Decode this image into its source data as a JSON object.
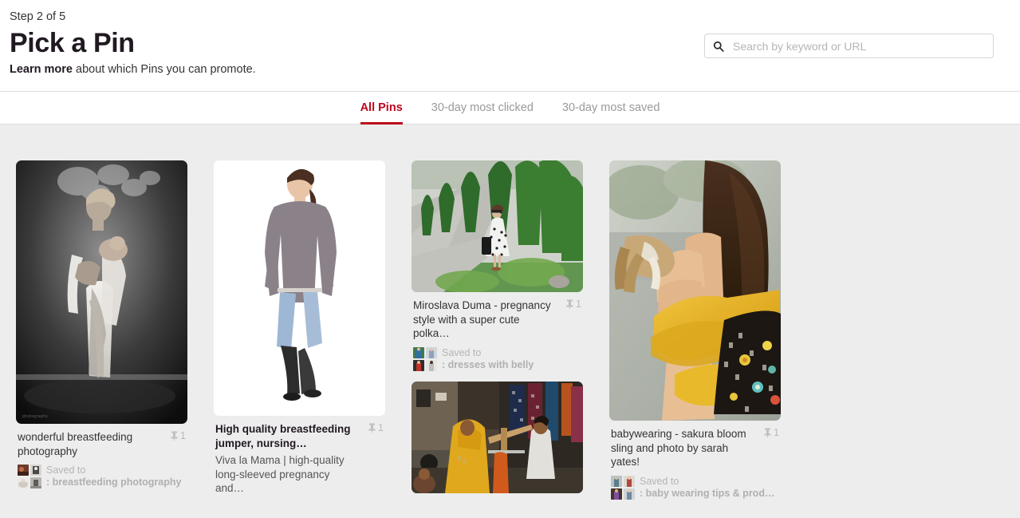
{
  "header": {
    "step_label": "Step 2 of 5",
    "title": "Pick a Pin",
    "learn_more": "Learn more",
    "subline_rest": " about which Pins you can promote.",
    "search": {
      "placeholder": "Search by keyword or URL",
      "value": "",
      "icon": "search-icon"
    }
  },
  "tabs": [
    {
      "label": "All Pins",
      "active": true
    },
    {
      "label": "30-day most clicked",
      "active": false
    },
    {
      "label": "30-day most saved",
      "active": false
    }
  ],
  "colors": {
    "accent": "#bd081c",
    "page_bg": "#ededed",
    "panel_bg": "#ffffff",
    "text": "#333333",
    "muted": "#b5b5b5"
  },
  "pins": [
    {
      "title": "wonderful breastfeeding photography",
      "bold_title": false,
      "description": "",
      "pin_count": "1",
      "pin_icon": "pushpin-icon",
      "saved_to_label": "Saved to",
      "board_name": ": breastfeeding photography",
      "image_alt": "black-and-white photo of mother breastfeeding baby outdoors"
    },
    {
      "title": "High quality breastfeeding jumper, nursing…",
      "bold_title": true,
      "description": "Viva la Mama | high-quality long-sleeved pregnancy and…",
      "pin_count": "1",
      "pin_icon": "pushpin-icon",
      "saved_to_label": "",
      "board_name": "",
      "image_alt": "woman wearing grey nursing jumper with jeans and boots on white background"
    },
    {
      "title": "Miroslava Duma - pregnancy style with a super cute polka…",
      "bold_title": false,
      "description": "",
      "pin_count": "1",
      "pin_icon": "pushpin-icon",
      "saved_to_label": "Saved to",
      "board_name": ": dresses with belly",
      "image_alt": "woman in polka dot dress standing on path beside green hedges"
    },
    {
      "title": "",
      "bold_title": false,
      "description": "",
      "pin_count": "",
      "pin_icon": "",
      "saved_to_label": "",
      "board_name": "",
      "image_alt": "indian street market scene with woman in yellow sari"
    },
    {
      "title": "babywearing - sakura bloom sling and photo by sarah yates!",
      "bold_title": false,
      "description": "",
      "pin_count": "1",
      "pin_icon": "pushpin-icon",
      "saved_to_label": "Saved to",
      "board_name": ": baby wearing tips & prod…",
      "image_alt": "back view of woman carrying baby in yellow sling"
    }
  ]
}
